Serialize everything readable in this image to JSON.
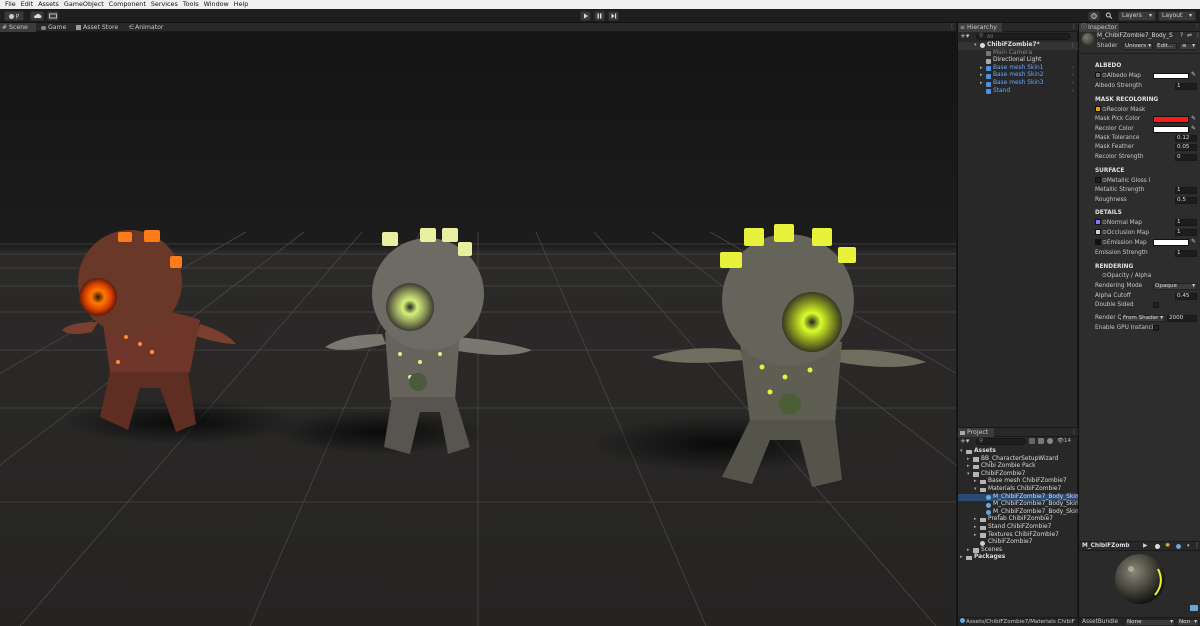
{
  "menu": [
    "File",
    "Edit",
    "Assets",
    "GameObject",
    "Component",
    "Services",
    "Tools",
    "Window",
    "Help"
  ],
  "toolbar": {
    "account_initial": "P",
    "layers_label": "Layers",
    "layout_label": "Layout"
  },
  "scene_tabs": [
    {
      "label": "Scene",
      "icon": "hash-icon"
    },
    {
      "label": "Game",
      "icon": "gamepad-icon"
    },
    {
      "label": "Asset Store",
      "icon": "store-icon"
    },
    {
      "label": "Animator",
      "icon": "animator-icon"
    }
  ],
  "hierarchy": {
    "tab_label": "Hierarchy",
    "search_placeholder": "All",
    "root": "ChibiFZombie7*",
    "items": [
      {
        "label": "Main Camera",
        "style": "grey"
      },
      {
        "label": "Directional Light",
        "style": "white"
      },
      {
        "label": "Base mesh Skin1",
        "style": "blue"
      },
      {
        "label": "Base mesh Skin2",
        "style": "blue"
      },
      {
        "label": "Base mesh Skin3",
        "style": "blue"
      },
      {
        "label": "Stand",
        "style": "blue"
      }
    ]
  },
  "project": {
    "tab_label": "Project",
    "hidden_count": "14",
    "tree": [
      {
        "label": "Assets",
        "depth": 0,
        "kind": "folder",
        "bold": true
      },
      {
        "label": "BB_CharacterSetupWizard",
        "depth": 1,
        "kind": "folder"
      },
      {
        "label": "Chibi Zombie Pack",
        "depth": 1,
        "kind": "folder"
      },
      {
        "label": "ChibiFZombie7",
        "depth": 1,
        "kind": "folder"
      },
      {
        "label": "Base mesh ChibiFZombie7",
        "depth": 2,
        "kind": "folder"
      },
      {
        "label": "Materials ChibiFZombie7",
        "depth": 2,
        "kind": "folder"
      },
      {
        "label": "M_ChibiFZombie7_Body_Skin1",
        "depth": 3,
        "kind": "material",
        "selected": true
      },
      {
        "label": "M_ChibiFZombie7_Body_Skin2",
        "depth": 3,
        "kind": "material"
      },
      {
        "label": "M_ChibiFZombie7_Body_Skin3",
        "depth": 3,
        "kind": "material"
      },
      {
        "label": "Prefab ChibiFZombie7",
        "depth": 2,
        "kind": "folder"
      },
      {
        "label": "Stand ChibiFZombie7",
        "depth": 2,
        "kind": "folder"
      },
      {
        "label": "Textures ChibiFZombie7",
        "depth": 2,
        "kind": "folder"
      },
      {
        "label": "ChibiFZombie7",
        "depth": 2,
        "kind": "scene"
      },
      {
        "label": "Scenes",
        "depth": 1,
        "kind": "folder"
      },
      {
        "label": "Packages",
        "depth": 0,
        "kind": "folder",
        "bold": true
      }
    ],
    "path": "Assets/ChibiFZombie7/Materials ChibiF"
  },
  "inspector": {
    "tab_label": "Inspector",
    "material_name": "M_ChibiFZombie7_Body_S",
    "shader_label": "Shader",
    "shader_value": "Univers",
    "edit_label": "Edit...",
    "albedo": {
      "title": "ALBEDO",
      "map_label": "Albedo Map",
      "strength_label": "Albedo Strength",
      "strength": "1",
      "color": "#ffffff"
    },
    "mask": {
      "title": "MASK RECOLORING",
      "map_label": "Recolor Mask",
      "pick_label": "Mask Pick Color",
      "pick_color": "#ff1a1a",
      "recolor_label": "Recolor Color",
      "recolor_color": "#ffffff",
      "tolerance_label": "Mask Tolerance",
      "tolerance": "0.12",
      "feather_label": "Mask Feather",
      "feather": "0.05",
      "strength_label": "Recolor Strength",
      "strength": "0"
    },
    "surface": {
      "title": "SURFACE",
      "map_label": "Metallic Gloss I",
      "metallic_label": "Metallic Strength",
      "metallic": "1",
      "roughness_label": "Roughness",
      "roughness": "0.5"
    },
    "details": {
      "title": "DETAILS",
      "normal_label": "Normal Map",
      "normal": "1",
      "occlusion_label": "Occlusion Map",
      "occlusion": "1",
      "emission_label": "Emission Map",
      "emission_color": "#ffffff",
      "emission_strength_label": "Emission Strength",
      "emission_strength": "1"
    },
    "rendering": {
      "title": "RENDERING",
      "opacity_label": "Opacity / Alpha",
      "mode_label": "Rendering Mode",
      "mode_value": "Opaque",
      "cutoff_label": "Alpha Cutoff",
      "cutoff": "0.45",
      "double_label": "Double Sided",
      "queue_label": "Render Q",
      "queue_mode": "From Shader",
      "queue_value": "2000",
      "gpu_label": "Enable GPU Instanci"
    },
    "preview_name": "M_ChibiFZomb",
    "assetbundle_label": "AssetBundle",
    "assetbundle_value": "None",
    "variant_value": "Non"
  }
}
